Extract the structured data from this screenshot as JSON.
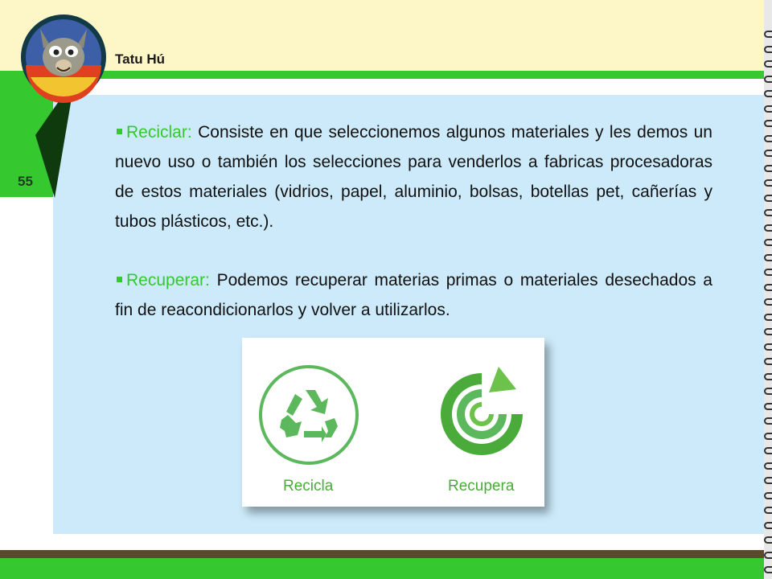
{
  "header": {
    "author": "Tatu Hú"
  },
  "page": {
    "number": "55"
  },
  "paragraphs": [
    {
      "term": "Reciclar:",
      "text": "Consiste en que seleccionemos algunos materiales y les demos un nuevo uso o también los selecciones para venderlos a fabricas procesadoras de estos materiales (vidrios, papel, aluminio, bolsas, botellas pet, cañerías y tubos plásticos, etc.)."
    },
    {
      "term": "Recuperar:",
      "text": "Podemos recuperar materias primas o materiales desechados a fin de reacondicionarlos y volver a utilizarlos."
    }
  ],
  "figure": {
    "left_label": "Recicla",
    "right_label": "Recupera"
  },
  "colors": {
    "accent_green": "#36c82f",
    "panel_blue": "#cceafa",
    "header_cream": "#fdf6c7",
    "label_green": "#4aab3a"
  },
  "icons": {
    "logo": "armadillo-mascot-logo",
    "left": "recycle-icon",
    "right": "recovery-cycle-icon"
  }
}
